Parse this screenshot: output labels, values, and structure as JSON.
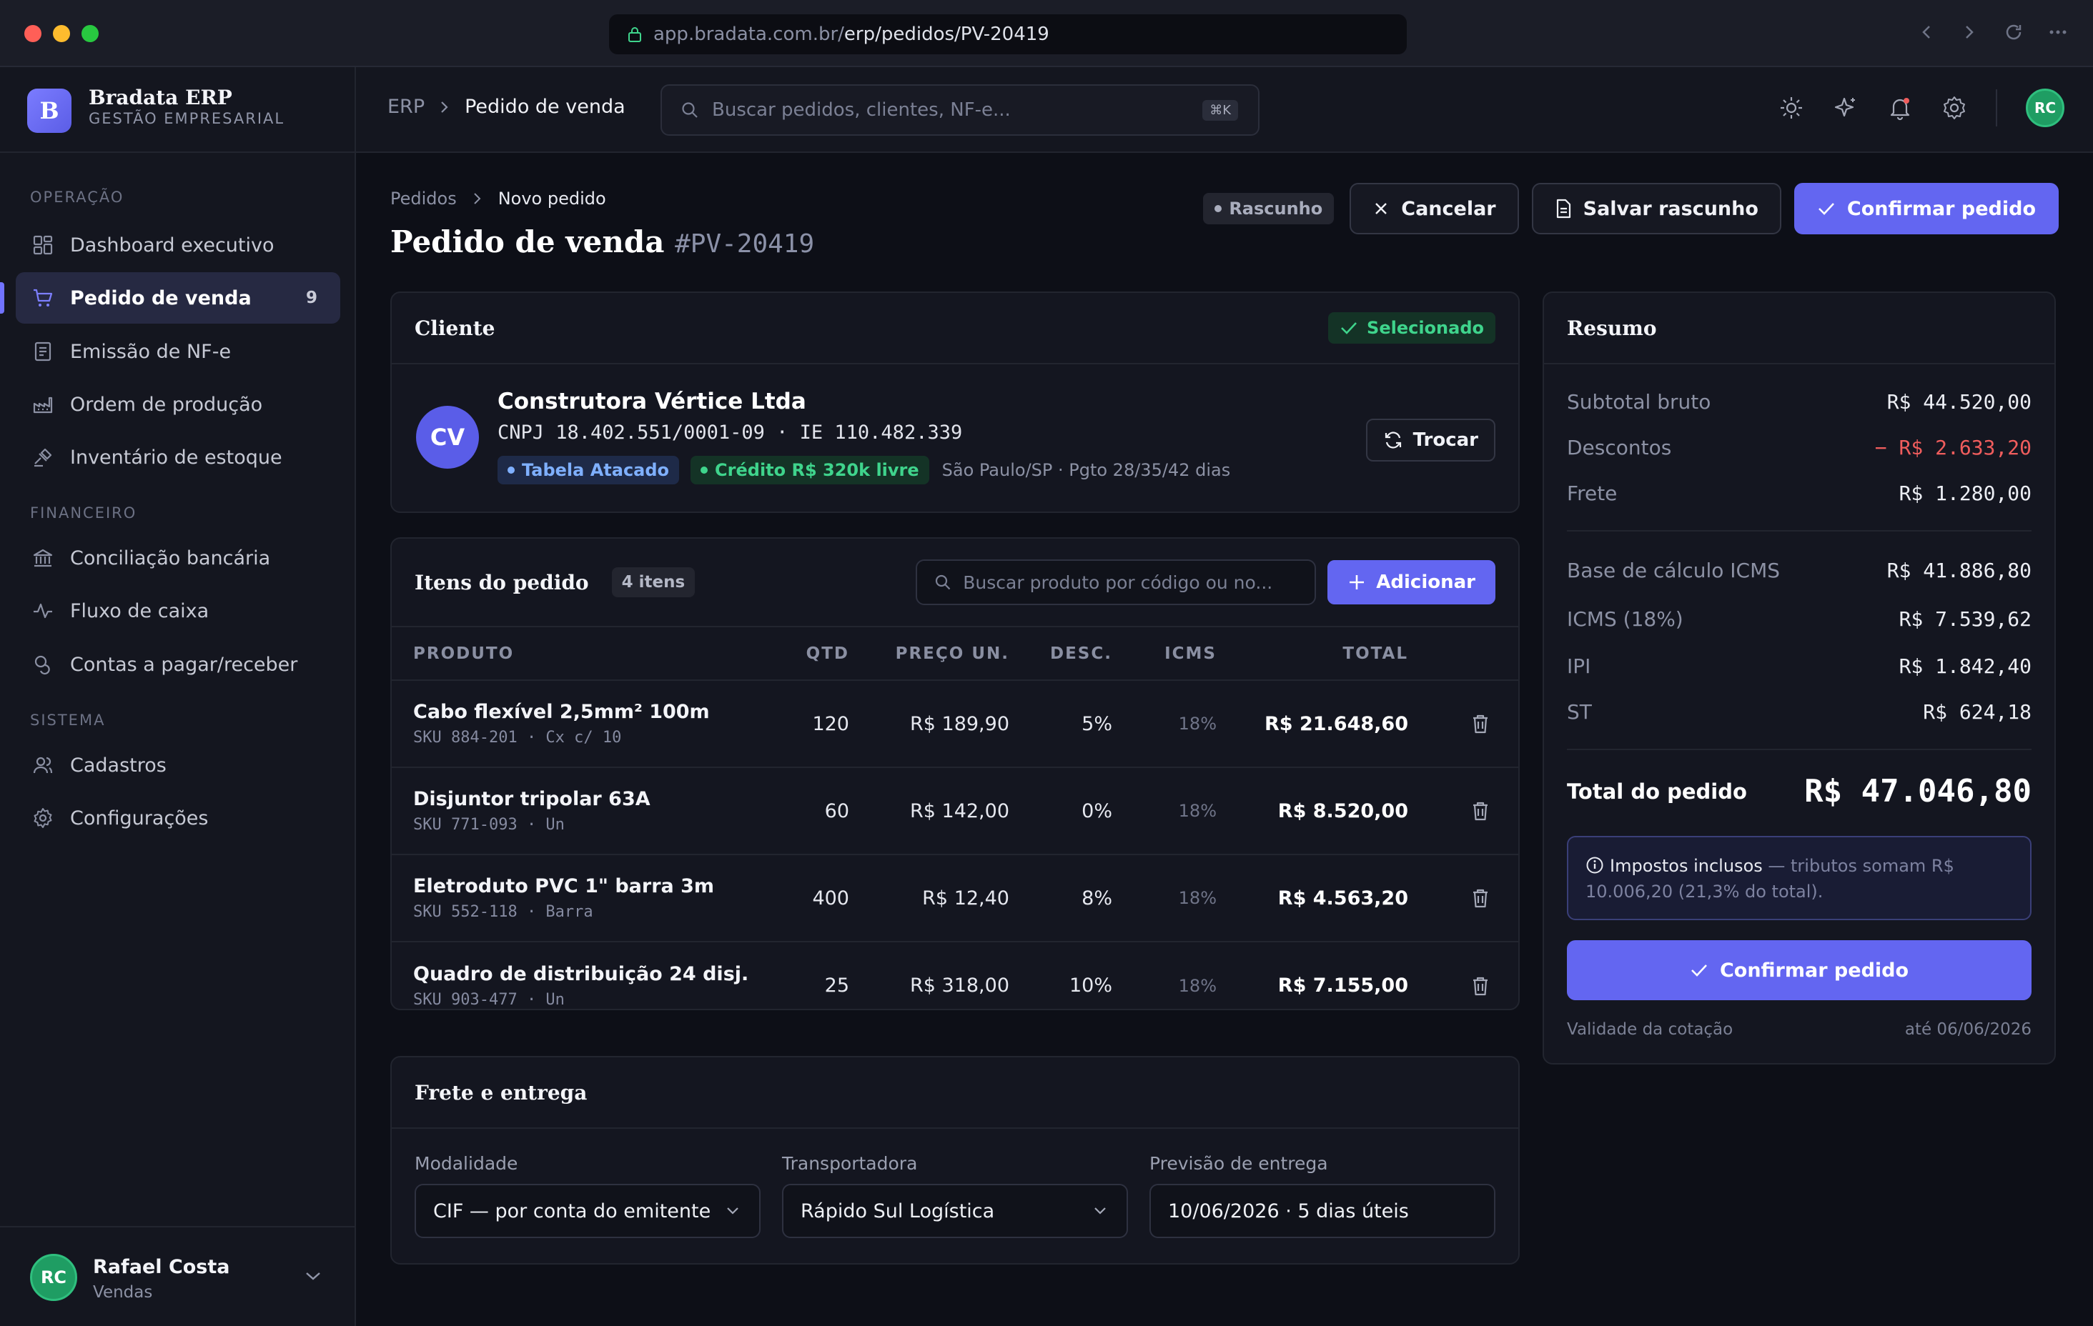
{
  "browser": {
    "url_domain": "app.bradata.com.br/",
    "url_path": "erp/pedidos/PV-20419"
  },
  "brand": {
    "name": "Bradata ERP",
    "subtitle": "GESTÃO EMPRESARIAL",
    "logo_letter": "B"
  },
  "sidebar": {
    "sections": [
      {
        "label": "OPERAÇÃO"
      },
      {
        "label": "FINANCEIRO"
      },
      {
        "label": "SISTEMA"
      }
    ],
    "items": [
      {
        "label": "Dashboard executivo",
        "icon": "dashboard-icon"
      },
      {
        "label": "Pedido de venda",
        "icon": "cart-icon",
        "badge": "9",
        "active": true
      },
      {
        "label": "Emissão de NF-e",
        "icon": "invoice-icon"
      },
      {
        "label": "Ordem de produção",
        "icon": "factory-icon"
      },
      {
        "label": "Inventário de estoque",
        "icon": "box-icon"
      },
      {
        "label": "Conciliação bancária",
        "icon": "bank-icon"
      },
      {
        "label": "Fluxo de caixa",
        "icon": "activity-icon"
      },
      {
        "label": "Contas a pagar/receber",
        "icon": "coins-icon"
      },
      {
        "label": "Cadastros",
        "icon": "users-icon"
      },
      {
        "label": "Configurações",
        "icon": "gear-icon"
      }
    ]
  },
  "user": {
    "initials": "RC",
    "name": "Rafael Costa",
    "role": "Vendas"
  },
  "topbar": {
    "crumb_root": "ERP",
    "crumb_current": "Pedido de venda",
    "search_placeholder": "Buscar pedidos, clientes, NF-e...",
    "search_shortcut": "⌘K",
    "avatar_initials": "RC"
  },
  "page": {
    "breadcrumb_parent": "Pedidos",
    "breadcrumb_current": "Novo pedido",
    "title": "Pedido de venda",
    "order_id": "#PV-20419",
    "status": "Rascunho",
    "cancel_label": "Cancelar",
    "save_draft_label": "Salvar rascunho",
    "confirm_label": "Confirmar pedido"
  },
  "client": {
    "section_title": "Cliente",
    "selected_label": "Selecionado",
    "initials": "CV",
    "name": "Construtora Vértice Ltda",
    "docs": "CNPJ 18.402.551/0001-09 · IE 110.482.339",
    "price_table": "Tabela Atacado",
    "credit": "Crédito R$ 320k livre",
    "location_terms": "São Paulo/SP · Pgto 28/35/42 dias",
    "swap_label": "Trocar"
  },
  "items": {
    "section_title": "Itens do pedido",
    "count_label": "4 itens",
    "search_placeholder": "Buscar produto por código ou no...",
    "add_label": "Adicionar",
    "columns": [
      "PRODUTO",
      "QTD",
      "PREÇO UN.",
      "DESC.",
      "ICMS",
      "TOTAL"
    ],
    "rows": [
      {
        "name": "Cabo flexível 2,5mm² 100m",
        "sku": "SKU 884-201 · Cx c/ 10",
        "qty": "120",
        "price": "R$ 189,90",
        "disc": "5%",
        "icms": "18%",
        "total": "R$ 21.648,60"
      },
      {
        "name": "Disjuntor tripolar 63A",
        "sku": "SKU 771-093 · Un",
        "qty": "60",
        "price": "R$ 142,00",
        "disc": "0%",
        "icms": "18%",
        "total": "R$ 8.520,00"
      },
      {
        "name": "Eletroduto PVC 1\" barra 3m",
        "sku": "SKU 552-118 · Barra",
        "qty": "400",
        "price": "R$ 12,40",
        "disc": "8%",
        "icms": "18%",
        "total": "R$ 4.563,20"
      },
      {
        "name": "Quadro de distribuição 24 disj.",
        "sku": "SKU 903-477 · Un",
        "qty": "25",
        "price": "R$ 318,00",
        "disc": "10%",
        "icms": "18%",
        "total": "R$ 7.155,00"
      }
    ]
  },
  "shipping": {
    "section_title": "Frete e entrega",
    "modality_label": "Modalidade",
    "modality_value": "CIF — por conta do emitente",
    "carrier_label": "Transportadora",
    "carrier_value": "Rápido Sul Logística",
    "delivery_label": "Previsão de entrega",
    "delivery_value": "10/06/2026 · 5 dias úteis"
  },
  "summary": {
    "title": "Resumo",
    "subtotal_label": "Subtotal bruto",
    "subtotal": "R$ 44.520,00",
    "discount_label": "Descontos",
    "discount": "− R$ 2.633,20",
    "freight_label": "Frete",
    "freight": "R$ 1.280,00",
    "icms_base_label": "Base de cálculo ICMS",
    "icms_base": "R$ 41.886,80",
    "icms_label": "ICMS (18%)",
    "icms": "R$ 7.539,62",
    "ipi_label": "IPI",
    "ipi": "R$ 1.842,40",
    "st_label": "ST",
    "st": "R$ 624,18",
    "total_label": "Total do pedido",
    "total": "R$ 47.046,80",
    "tax_note_strong": "Impostos inclusos",
    "tax_note_rest": " — tributos somam R$ 10.006,20 (21,3% do total).",
    "confirm_label": "Confirmar pedido",
    "validity_label": "Validade da cotação",
    "validity_value": "até 06/06/2026"
  },
  "colors": {
    "accent": "#6366f1",
    "success": "#3fd48c",
    "danger": "#f05d5d",
    "info": "#7fb0ff"
  }
}
